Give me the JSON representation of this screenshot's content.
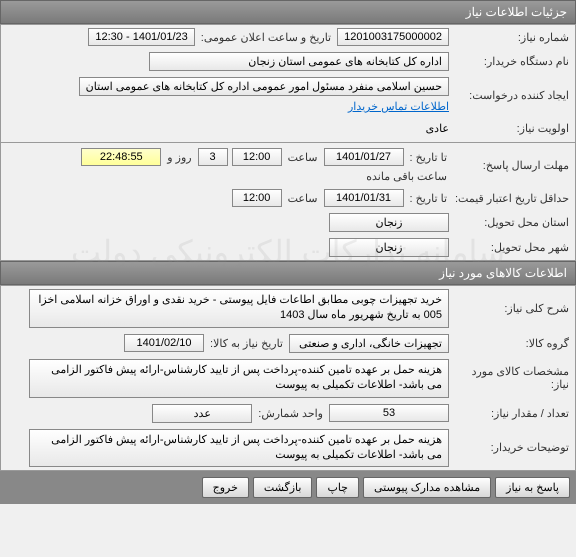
{
  "headers": {
    "need_info": "جزئیات اطلاعات نیاز",
    "goods_info": "اطلاعات کالاهای مورد نیاز"
  },
  "labels": {
    "need_number": "شماره نیاز:",
    "buyer_org": "نام دستگاه خریدار:",
    "request_creator": "ایجاد کننده درخواست:",
    "priority": "اولویت نیاز:",
    "response_deadline": "مهلت ارسال پاسخ:",
    "price_validity": "حداقل تاریخ اعتبار قیمت:",
    "delivery_province": "استان محل تحویل:",
    "delivery_city": "شهر محل تحویل:",
    "need_desc": "شرح کلی نیاز:",
    "goods_group": "گروه کالا:",
    "goods_spec": "مشخصات کالای مورد نیاز:",
    "quantity": "تعداد / مقدار نیاز:",
    "buyer_notes": "توضیحات خریدار:",
    "announce_datetime": "تاریخ و ساعت اعلان عمومی:",
    "to_date": "تا تاریخ :",
    "hour": "ساعت",
    "days_and": "روز و",
    "hours_remain": "ساعت باقی مانده",
    "need_date_for": "تاریخ نیاز به کالا:",
    "count_unit": "واحد شمارش:",
    "contact_link": "اطلاعات تماس خریدار"
  },
  "values": {
    "need_number": "1201003175000002",
    "announce_datetime": "1401/01/23 - 12:30",
    "buyer_org": "اداره کل کتابخانه های عمومی استان زنجان",
    "request_creator": "حسین اسلامی منفرد مسئول امور عمومی اداره کل کتابخانه های عمومی استان",
    "priority": "عادی",
    "response_date": "1401/01/27",
    "response_hour": "12:00",
    "remain_days": "3",
    "remain_time": "22:48:55",
    "price_valid_date": "1401/01/31",
    "price_valid_hour": "12:00",
    "province": "زنجان",
    "city": "زنجان",
    "need_desc": "خرید تجهیزات چوبی مطابق اطاعات فایل پیوستی - خرید نقدی و اوراق خزانه اسلامی اخزا 005 به تاریخ شهریور ماه سال 1403",
    "goods_group": "تجهیزات خانگی، اداری و صنعتی",
    "need_date": "1401/02/10",
    "goods_spec": "هزینه حمل بر عهده تامین کننده-پرداخت پس از تایید کارشناس-ارائه پیش فاکتور الزامی می باشد- اطلاعات تکمیلی به پیوست",
    "quantity": "53",
    "unit": "عدد",
    "buyer_notes": "هزینه حمل بر عهده تامین کننده-پرداخت پس از تایید کارشناس-ارائه پیش فاکتور الزامی می باشد- اطلاعات تکمیلی به پیوست"
  },
  "buttons": {
    "respond": "پاسخ به نیاز",
    "view_attach": "مشاهده مدارک پیوستی",
    "print": "چاپ",
    "back": "بازگشت",
    "exit": "خروج"
  },
  "watermark": "سامانه تدارکات الکترونیکی دولت"
}
